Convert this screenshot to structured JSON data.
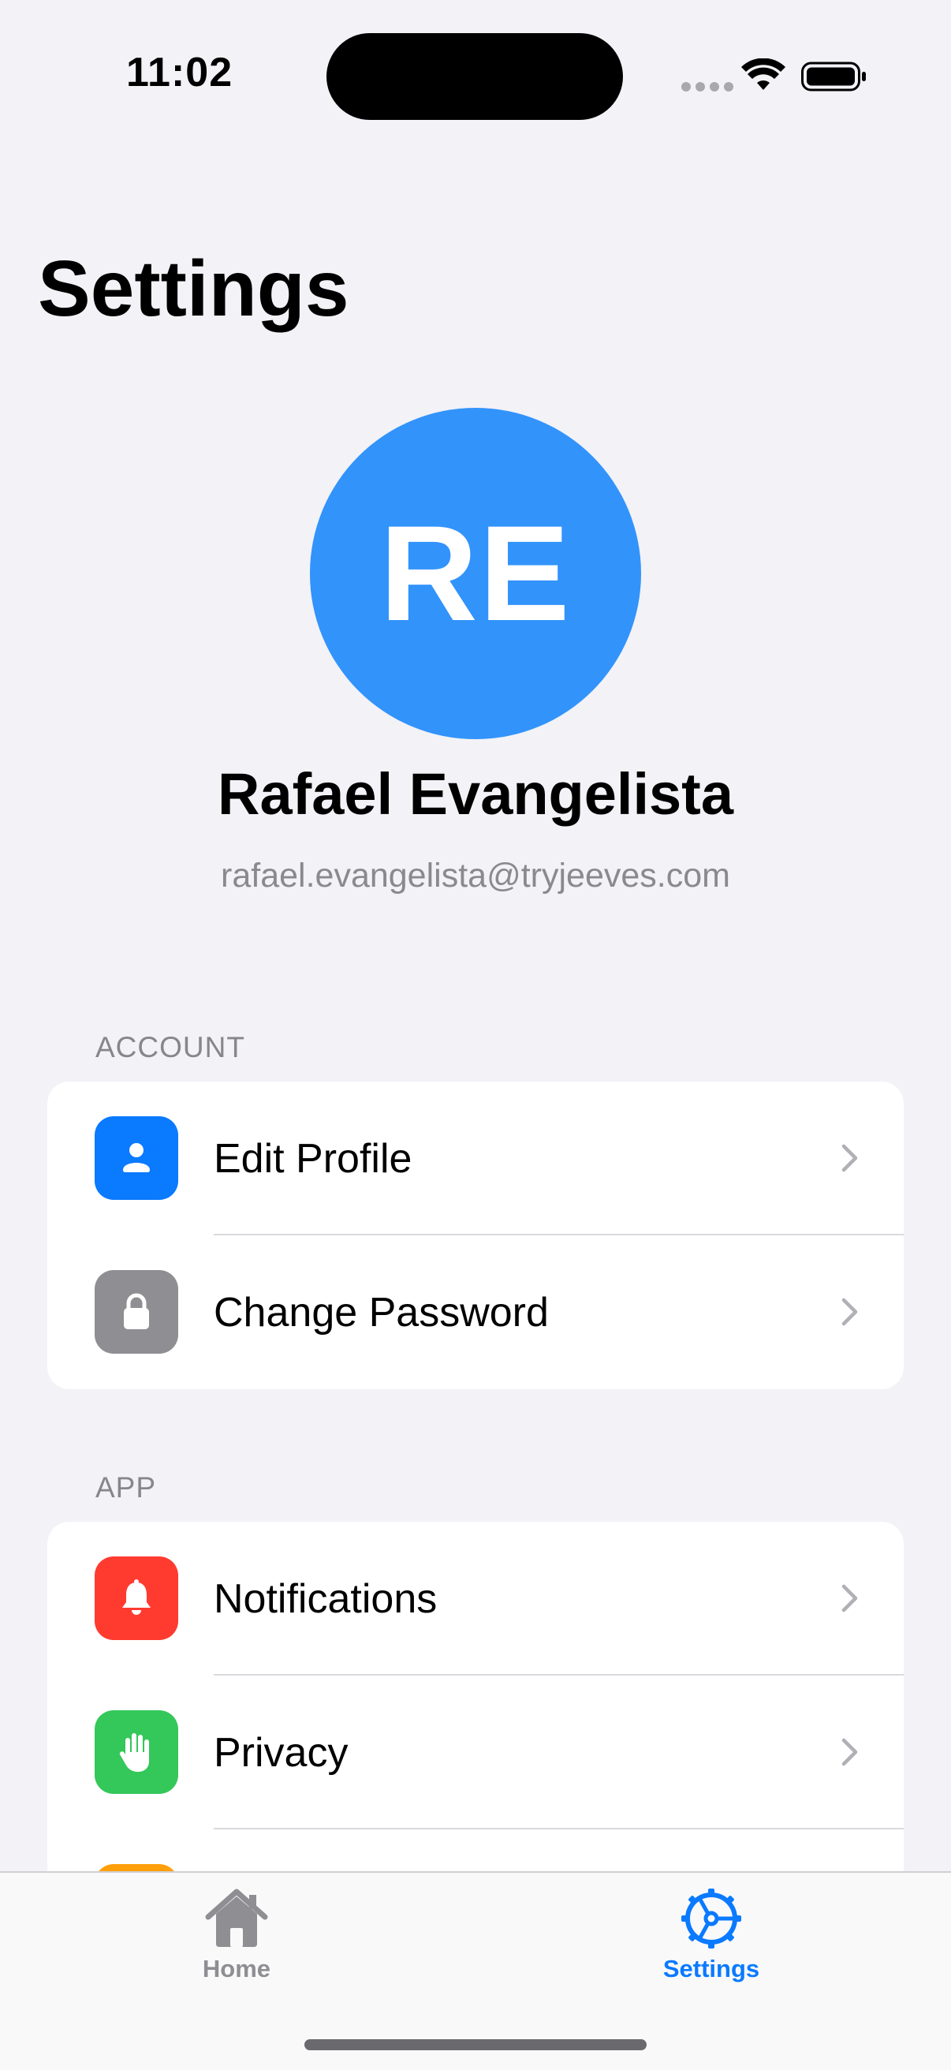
{
  "status_bar": {
    "time": "11:02"
  },
  "page": {
    "title": "Settings"
  },
  "profile": {
    "initials": "RE",
    "name": "Rafael Evangelista",
    "email": "rafael.evangelista@tryjeeves.com",
    "avatar_color": "#3293fb"
  },
  "sections": {
    "account": {
      "header": "ACCOUNT",
      "items": [
        {
          "label": "Edit Profile",
          "icon": "person-icon",
          "icon_color": "#0a7aff"
        },
        {
          "label": "Change Password",
          "icon": "lock-icon",
          "icon_color": "#8e8e93"
        }
      ]
    },
    "app": {
      "header": "APP",
      "items": [
        {
          "label": "Notifications",
          "icon": "bell-icon",
          "icon_color": "#ff3b30"
        },
        {
          "label": "Privacy",
          "icon": "hand-icon",
          "icon_color": "#34c759"
        },
        {
          "label": "",
          "icon": "partial-icon",
          "icon_color": "#ff9f0a"
        }
      ]
    }
  },
  "tab_bar": {
    "tabs": [
      {
        "label": "Home",
        "icon": "house-icon",
        "active": false,
        "color": "#8e8e93"
      },
      {
        "label": "Settings",
        "icon": "gear-icon",
        "active": true,
        "color": "#0a7aff"
      }
    ]
  }
}
